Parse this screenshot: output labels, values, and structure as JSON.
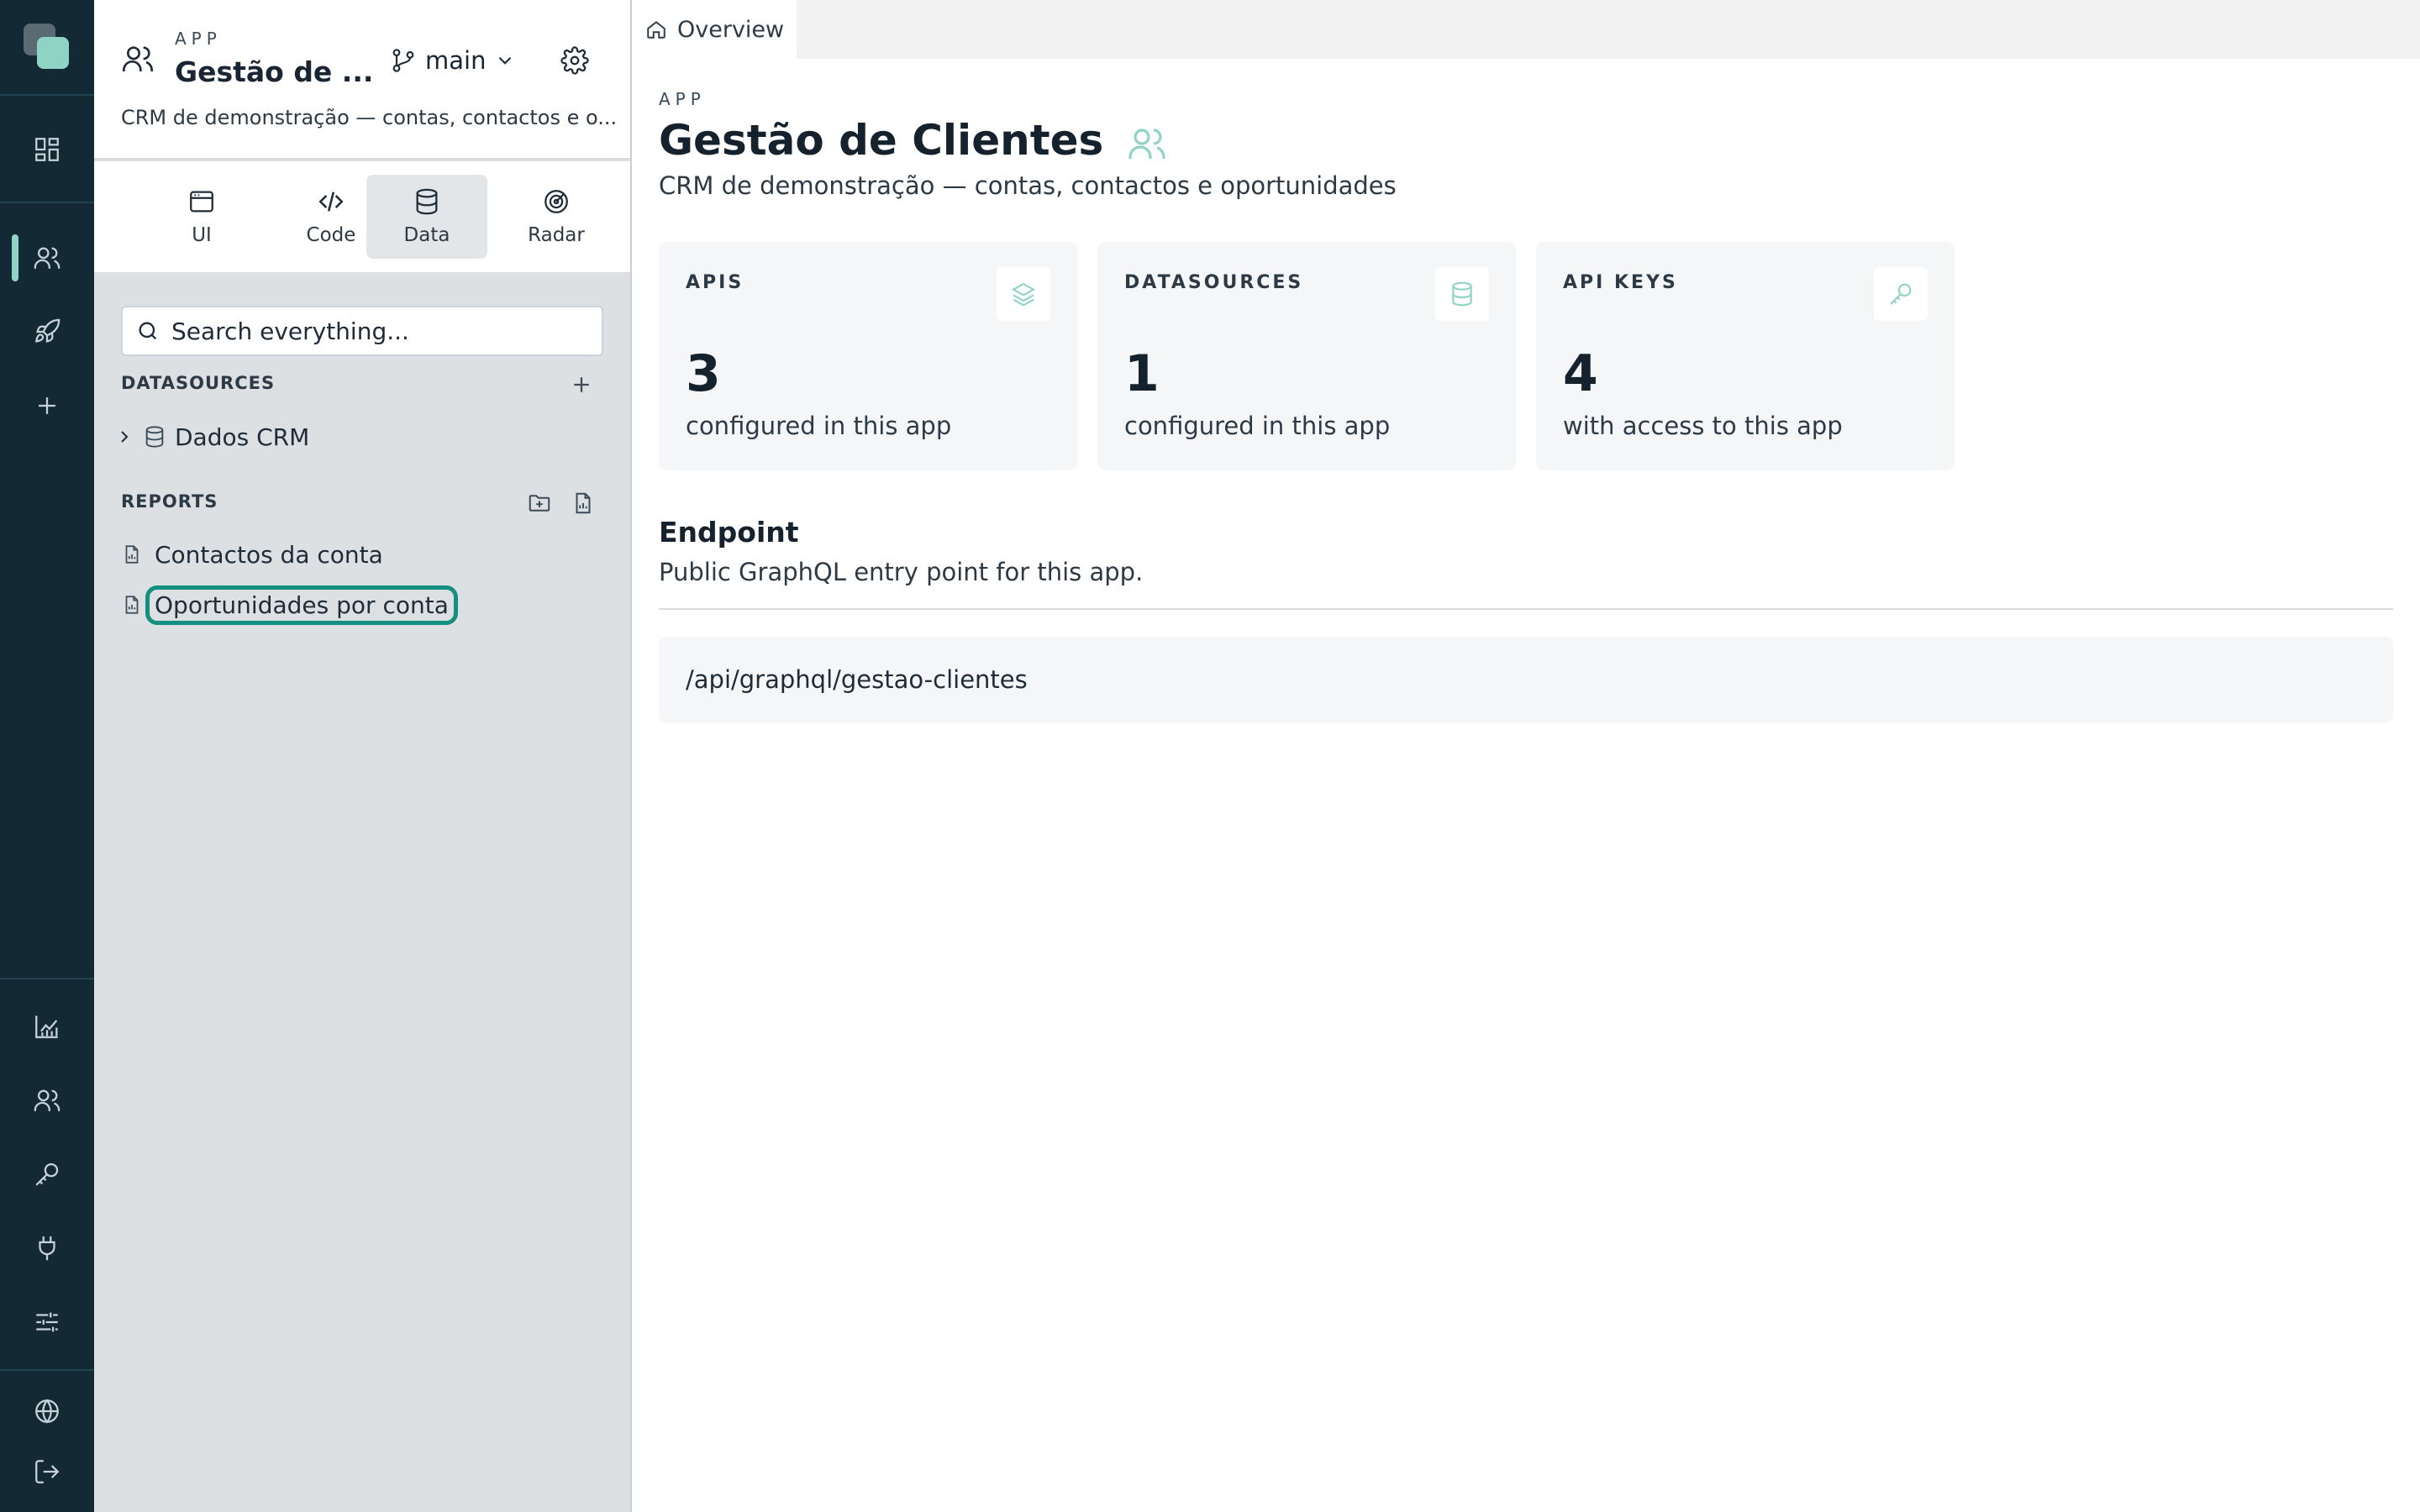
{
  "rail": {
    "items": [
      {
        "name": "dashboard-icon"
      },
      {
        "name": "users-icon",
        "active": true
      },
      {
        "name": "rocket-icon"
      },
      {
        "name": "plus-icon"
      },
      {
        "name": "chart-icon"
      },
      {
        "name": "team-icon"
      },
      {
        "name": "key-icon"
      },
      {
        "name": "plug-icon"
      },
      {
        "name": "sliders-icon"
      },
      {
        "name": "globe-icon"
      },
      {
        "name": "logout-icon"
      }
    ]
  },
  "sidebar": {
    "eyebrow": "APP",
    "title": "Gestão de ...",
    "description": "CRM de demonstração — contas, contactos e o...",
    "branch": "main",
    "tabs": [
      {
        "label": "UI",
        "icon": "window-icon"
      },
      {
        "label": "Code",
        "icon": "code-icon"
      },
      {
        "label": "Data",
        "icon": "database-icon",
        "active": true
      },
      {
        "label": "Radar",
        "icon": "radar-icon"
      }
    ],
    "search": {
      "placeholder": "Search everything..."
    },
    "datasources": {
      "label": "DATASOURCES",
      "items": [
        {
          "label": "Dados CRM"
        }
      ]
    },
    "reports": {
      "label": "REPORTS",
      "items": [
        {
          "label": "Contactos da conta"
        },
        {
          "label": "Oportunidades por conta",
          "focused": true
        }
      ]
    }
  },
  "main": {
    "tab": {
      "label": "Overview"
    },
    "eyebrow": "APP",
    "title": "Gestão de Clientes",
    "description": "CRM de demonstração — contas, contactos e oportunidades",
    "cards": [
      {
        "label": "APIS",
        "value": "3",
        "sub": "configured in this app",
        "icon": "layers-icon"
      },
      {
        "label": "DATASOURCES",
        "value": "1",
        "sub": "configured in this app",
        "icon": "database-icon"
      },
      {
        "label": "API KEYS",
        "value": "4",
        "sub": "with access to this app",
        "icon": "key-icon"
      }
    ],
    "endpoint": {
      "title": "Endpoint",
      "description": "Public GraphQL entry point for this app.",
      "path": "/api/graphql/gestao-clientes"
    }
  },
  "colors": {
    "rail_bg": "#132a35",
    "accent": "#8fd3c4",
    "focus_ring": "#148f80",
    "sidebar_bg": "#dde0e3"
  }
}
